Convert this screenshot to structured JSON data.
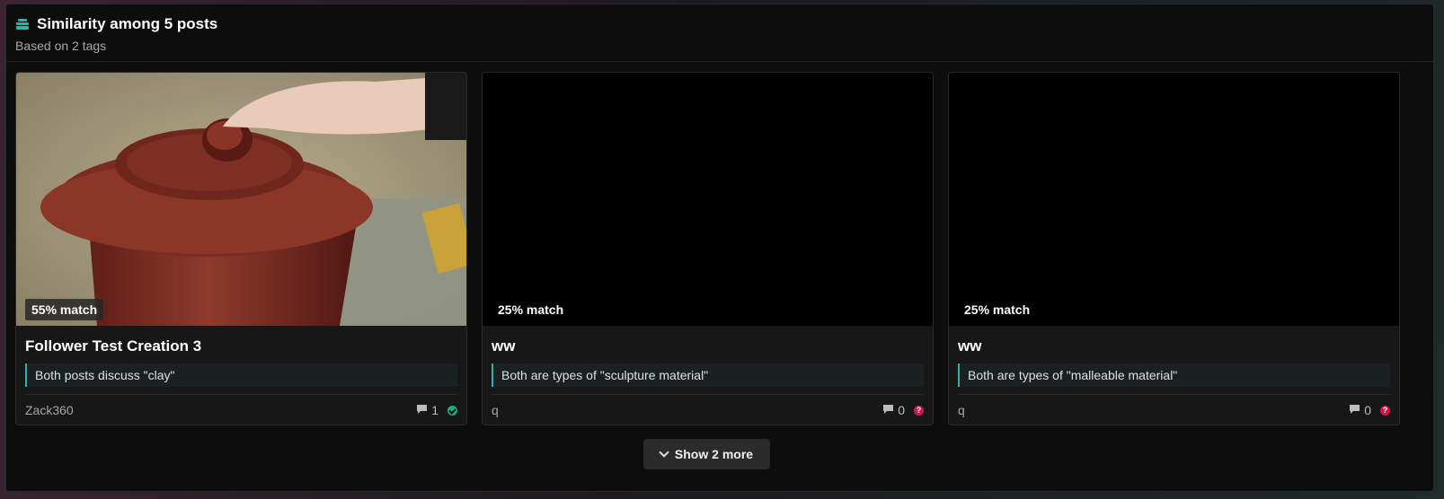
{
  "header": {
    "title": "Similarity among 5 posts",
    "subtitle": "Based on 2 tags"
  },
  "cards": [
    {
      "match": "55% match",
      "title": "Follower Test Creation 3",
      "reason": "Both posts discuss \"clay\"",
      "author": "Zack360",
      "comments": "1",
      "status": "verified"
    },
    {
      "match": "25% match",
      "title": "ww",
      "reason": "Both are types of \"sculpture material\"",
      "author": "q",
      "comments": "0",
      "status": "unknown"
    },
    {
      "match": "25% match",
      "title": "ww",
      "reason": "Both are types of \"malleable material\"",
      "author": "q",
      "comments": "0",
      "status": "unknown"
    }
  ],
  "footer": {
    "show_more_label": "Show 2 more"
  },
  "colors": {
    "accent": "#2fb3a8",
    "ok": "#1fae7a",
    "warn": "#d4144a"
  }
}
